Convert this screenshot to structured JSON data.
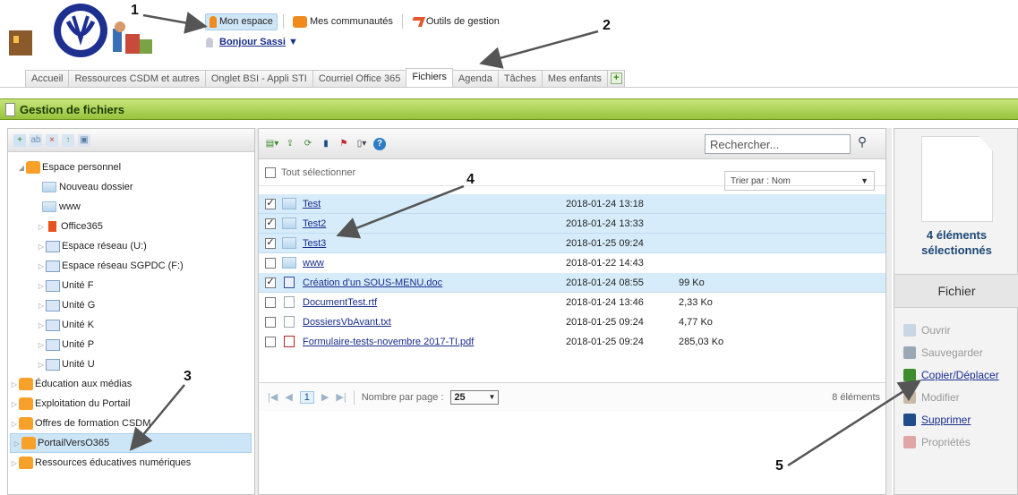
{
  "header": {
    "nav": [
      {
        "label": "Mon espace",
        "icon": "person-icon"
      },
      {
        "label": "Mes communautés",
        "icon": "community-icon"
      },
      {
        "label": "Outils de gestion",
        "icon": "tools-icon"
      }
    ],
    "greeting": "Bonjour Sassi"
  },
  "tabs": [
    "Accueil",
    "Ressources CSDM et autres",
    "Onglet BSI - Appli STI",
    "Courriel Office 365",
    "Fichiers",
    "Agenda",
    "Tâches",
    "Mes enfants"
  ],
  "active_tab": "Fichiers",
  "section_title": "Gestion de fichiers",
  "tree": {
    "items": [
      {
        "label": "Espace personnel",
        "level": 0,
        "type": "personal"
      },
      {
        "label": "Nouveau dossier",
        "level": 1,
        "type": "folder"
      },
      {
        "label": "www",
        "level": 1,
        "type": "folder-web"
      },
      {
        "label": "Office365",
        "level": 1,
        "type": "office"
      },
      {
        "label": "Espace réseau (U:)",
        "level": 1,
        "type": "network"
      },
      {
        "label": "Espace réseau SGPDC (F:)",
        "level": 1,
        "type": "network"
      },
      {
        "label": "Unité F",
        "level": 1,
        "type": "network"
      },
      {
        "label": "Unité G",
        "level": 1,
        "type": "network"
      },
      {
        "label": "Unité K",
        "level": 1,
        "type": "network"
      },
      {
        "label": "Unité P",
        "level": 1,
        "type": "network"
      },
      {
        "label": "Unité U",
        "level": 1,
        "type": "network"
      },
      {
        "label": "Éducation aux médias",
        "level": 0,
        "type": "community"
      },
      {
        "label": "Exploitation du Portail",
        "level": 0,
        "type": "community"
      },
      {
        "label": "Offres de formation CSDM",
        "level": 0,
        "type": "community"
      },
      {
        "label": "PortailVersO365",
        "level": 0,
        "type": "community",
        "selected": true
      },
      {
        "label": "Ressources éducatives numériques",
        "level": 0,
        "type": "community"
      }
    ]
  },
  "files": {
    "search_placeholder": "Rechercher...",
    "select_all": "Tout sélectionner",
    "sort_label": "Trier par : Nom",
    "rows": [
      {
        "name": "Test",
        "date": "2018-01-24 13:18",
        "size": "",
        "checked": true,
        "type": "folder"
      },
      {
        "name": "Test2",
        "date": "2018-01-24 13:33",
        "size": "",
        "checked": true,
        "type": "folder"
      },
      {
        "name": "Test3",
        "date": "2018-01-25 09:24",
        "size": "",
        "checked": true,
        "type": "folder"
      },
      {
        "name": "www",
        "date": "2018-01-22 14:43",
        "size": "",
        "checked": false,
        "type": "folder-web"
      },
      {
        "name": "Création d'un SOUS-MENU.doc",
        "date": "2018-01-24 08:55",
        "size": "99 Ko",
        "checked": true,
        "type": "word"
      },
      {
        "name": "DocumentTest.rtf",
        "date": "2018-01-24 13:46",
        "size": "2,33 Ko",
        "checked": false,
        "type": "doc"
      },
      {
        "name": "DossiersVbAvant.txt",
        "date": "2018-01-25 09:24",
        "size": "4,77 Ko",
        "checked": false,
        "type": "doc"
      },
      {
        "name": "Formulaire-tests-novembre 2017-TI.pdf",
        "date": "2018-01-25 09:24",
        "size": "285,03 Ko",
        "checked": false,
        "type": "pdf"
      }
    ],
    "pager": {
      "page": "1",
      "per_page_label": "Nombre par page :",
      "per_page": "25",
      "count": "8 éléments"
    }
  },
  "details": {
    "selection_line1": "4 éléments",
    "selection_line2": "sélectionnés",
    "title": "Fichier",
    "actions": [
      {
        "label": "Ouvrir",
        "enabled": false
      },
      {
        "label": "Sauvegarder",
        "enabled": false
      },
      {
        "label": "Copier/Déplacer",
        "enabled": true
      },
      {
        "label": "Modifier",
        "enabled": false
      },
      {
        "label": "Supprimer",
        "enabled": true
      },
      {
        "label": "Propriétés",
        "enabled": false
      }
    ]
  },
  "callouts": [
    "1",
    "2",
    "3",
    "4",
    "5"
  ]
}
